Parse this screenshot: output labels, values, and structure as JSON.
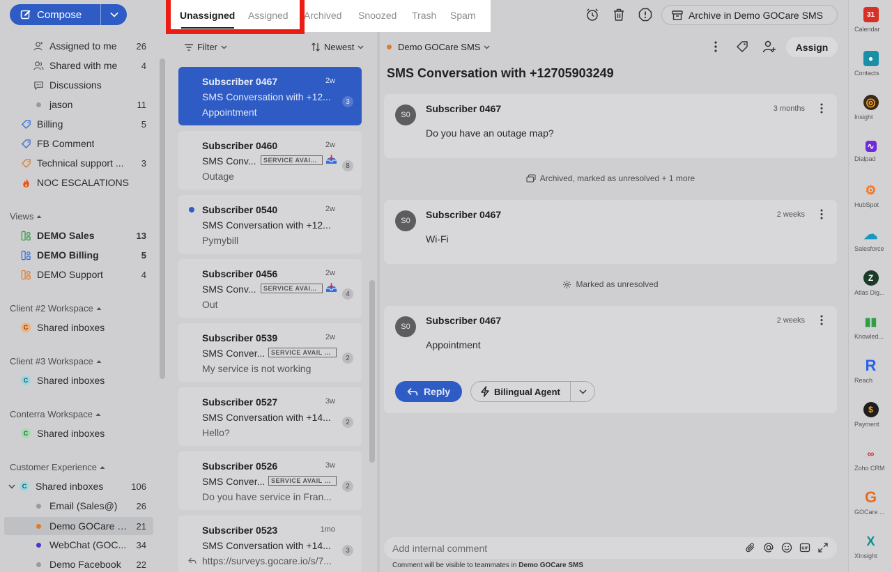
{
  "compose": {
    "label": "Compose"
  },
  "sidebar": {
    "top_items": [
      {
        "label": "Assigned to me",
        "count": "26"
      },
      {
        "label": "Shared with me",
        "count": "4"
      },
      {
        "label": "Discussions",
        "count": ""
      },
      {
        "label": "jason",
        "count": "11"
      }
    ],
    "tags": [
      {
        "label": "Billing",
        "count": "5"
      },
      {
        "label": "FB Comment",
        "count": ""
      },
      {
        "label": "Technical support ...",
        "count": "3"
      },
      {
        "label": "NOC ESCALATIONS",
        "count": ""
      }
    ],
    "views_title": "Views",
    "views": [
      {
        "label": "DEMO Sales",
        "count": "13"
      },
      {
        "label": "DEMO Billing",
        "count": "5"
      },
      {
        "label": "DEMO Support",
        "count": "4"
      }
    ],
    "ws2_title": "Client #2 Workspace",
    "ws2_item": {
      "label": "Shared inboxes",
      "badge": "C"
    },
    "ws3_title": "Client #3 Workspace",
    "ws3_item": {
      "label": "Shared inboxes",
      "badge": "C"
    },
    "conterra_title": "Conterra Workspace",
    "conterra_item": {
      "label": "Shared inboxes",
      "badge": "C"
    },
    "cx_title": "Customer Experience",
    "cx_item": {
      "label": "Shared inboxes",
      "badge": "C",
      "count": "106"
    },
    "cx_children": [
      {
        "label": "Email (Sales@)",
        "count": "26"
      },
      {
        "label": "Demo GOCare S...",
        "count": "21"
      },
      {
        "label": "WebChat (GOC...",
        "count": "34"
      },
      {
        "label": "Demo Facebook",
        "count": "22"
      }
    ]
  },
  "tabs": [
    "Unassigned",
    "Assigned",
    "Archived",
    "Snoozed",
    "Trash",
    "Spam"
  ],
  "toolbar": {
    "archive_label": "Archive in Demo GOCare SMS"
  },
  "list": {
    "filter_label": "Filter",
    "sort_label": "Newest",
    "conversations": [
      {
        "name": "Subscriber 0467",
        "time": "2w",
        "subject": "SMS Conversation with +12...",
        "preview": "Appointment",
        "count": "3",
        "tag": ""
      },
      {
        "name": "Subscriber 0460",
        "time": "2w",
        "subject": "SMS Conv...",
        "preview": "Outage",
        "count": "8",
        "tag": "SERVICE AVAI..."
      },
      {
        "name": "Subscriber 0540",
        "time": "2w",
        "subject": "SMS Conversation with +12...",
        "preview": "Pymybill",
        "count": "",
        "tag": ""
      },
      {
        "name": "Subscriber 0456",
        "time": "2w",
        "subject": "SMS Conv...",
        "preview": "Out",
        "count": "4",
        "tag": "SERVICE AVAI..."
      },
      {
        "name": "Subscriber 0539",
        "time": "2w",
        "subject": "SMS Conver...",
        "preview": "My service is not working",
        "count": "2",
        "tag": "SERVICE AVAIL ..."
      },
      {
        "name": "Subscriber 0527",
        "time": "3w",
        "subject": "SMS Conversation with +14...",
        "preview": "Hello?",
        "count": "2",
        "tag": ""
      },
      {
        "name": "Subscriber 0526",
        "time": "3w",
        "subject": "SMS Conver...",
        "preview": "Do you have service in Fran...",
        "count": "2",
        "tag": "SERVICE AVAIL ..."
      },
      {
        "name": "Subscriber 0523",
        "time": "1mo",
        "subject": "SMS Conversation with +14...",
        "preview": "https://surveys.gocare.io/s/7...",
        "count": "3",
        "tag": ""
      }
    ]
  },
  "conversation": {
    "inbox_label": "Demo GOCare SMS",
    "assign_label": "Assign",
    "title": "SMS Conversation with +12705903249",
    "messages": [
      {
        "avatar": "S0",
        "sender": "Subscriber 0467",
        "time": "3 months",
        "body": "Do you have an outage map?"
      },
      {
        "avatar": "S0",
        "sender": "Subscriber 0467",
        "time": "2 weeks",
        "body": "Wi-Fi"
      },
      {
        "avatar": "S0",
        "sender": "Subscriber 0467",
        "time": "2 weeks",
        "body": "Appointment"
      }
    ],
    "events": [
      "Archived, marked as unresolved + 1 more",
      "Marked as unresolved"
    ],
    "reply_label": "Reply",
    "agent_label": "Bilingual Agent",
    "comment_placeholder": "Add internal comment",
    "visibility_prefix": "Comment will be visible to teammates in ",
    "visibility_inbox": "Demo GOCare SMS"
  },
  "rail": [
    {
      "name": "Calendar",
      "icon": "calendar-icon",
      "color": "#d93025",
      "glyph": "31"
    },
    {
      "name": "Contacts",
      "icon": "contacts-icon",
      "color": "#1a8fa5",
      "glyph": "●"
    },
    {
      "name": "Insight",
      "icon": "insight-icon",
      "color": "#3a2a1a",
      "glyph": "◎"
    },
    {
      "name": "Dialpad",
      "icon": "dialpad-icon",
      "color": "#6d2bd9",
      "glyph": "∿"
    },
    {
      "name": "HubSpot",
      "icon": "hubspot-icon",
      "color": "#f57722",
      "glyph": "⚙"
    },
    {
      "name": "Salesforce",
      "icon": "salesforce-icon",
      "color": "#1798c1",
      "glyph": "☁"
    },
    {
      "name": "Atlas Dig...",
      "icon": "atlas-icon",
      "color": "#1b3a2a",
      "glyph": "Z"
    },
    {
      "name": "Knowled...",
      "icon": "knowledge-icon",
      "color": "#2f9e44",
      "glyph": "▮▮"
    },
    {
      "name": "Reach",
      "icon": "reach-icon",
      "color": "#2563eb",
      "glyph": "R"
    },
    {
      "name": "Payment",
      "icon": "payment-icon",
      "color": "#1e1e1e",
      "glyph": "$"
    },
    {
      "name": "Zoho CRM",
      "icon": "zoho-icon",
      "color": "#e8e8e8",
      "glyph": "∞"
    },
    {
      "name": "GOCare ...",
      "icon": "gocare-icon",
      "color": "#e86a1a",
      "glyph": "G"
    },
    {
      "name": "XInsight",
      "icon": "xinsight-icon",
      "color": "#0a8f8f",
      "glyph": "X"
    }
  ]
}
